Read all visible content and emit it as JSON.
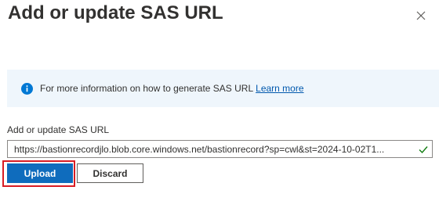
{
  "dialog": {
    "title": "Add or update SAS URL",
    "close_icon": "close-icon"
  },
  "info": {
    "icon": "info-icon",
    "text": "For more information on how to generate SAS URL",
    "link": "Learn more"
  },
  "form": {
    "label": "Add or update SAS URL",
    "value": "https://bastionrecordjlo.blob.core.windows.net/bastionrecord?sp=cwl&st=2024-10-02T1...",
    "valid_icon": "checkmark-icon"
  },
  "actions": {
    "upload_label": "Upload",
    "discard_label": "Discard"
  },
  "colors": {
    "primary": "#0f6cbd",
    "info_bg": "#eff6fc",
    "info_icon": "#0078d4",
    "link": "#0058ad",
    "valid": "#107c10",
    "highlight": "#d91d25"
  }
}
